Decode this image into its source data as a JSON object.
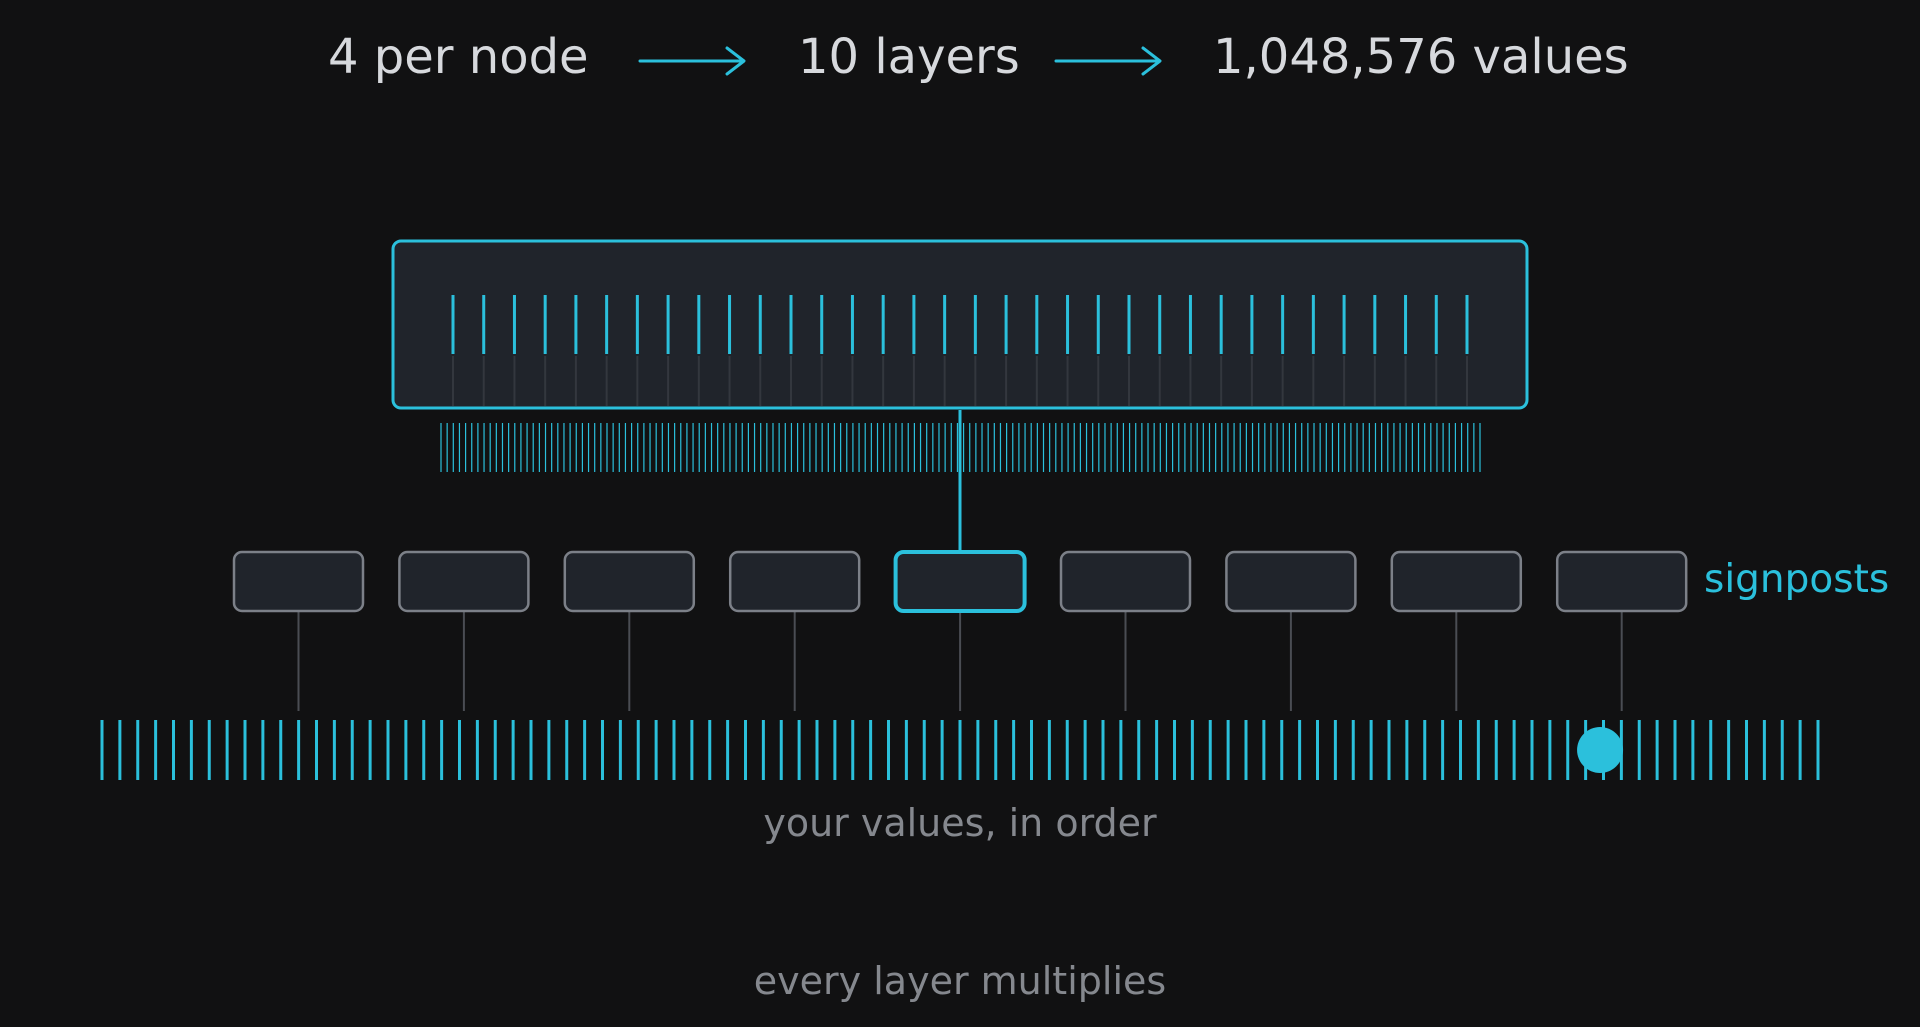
{
  "header": {
    "steps": [
      "4 per node",
      "10 layers",
      "1,048,576 values"
    ]
  },
  "labels": {
    "signposts": "signposts",
    "values_caption": "your values, in order",
    "footer": "every layer multiplies"
  },
  "structure": {
    "root_key_count": 34,
    "child_line_count": 170,
    "signpost_count": 9,
    "highlighted_signpost": 5,
    "value_tick_count": 97,
    "marker_position": 0.873
  },
  "colors": {
    "background": "#111112",
    "accent": "#2bc0dc",
    "node_fill": "#20242b",
    "node_border": "#7c8088",
    "connector": "#4a4d53",
    "text": "#d7d9dd",
    "muted_text": "#85888e"
  },
  "icons": {
    "arrow": "right-arrow-icon",
    "marker": "position-marker-icon"
  }
}
